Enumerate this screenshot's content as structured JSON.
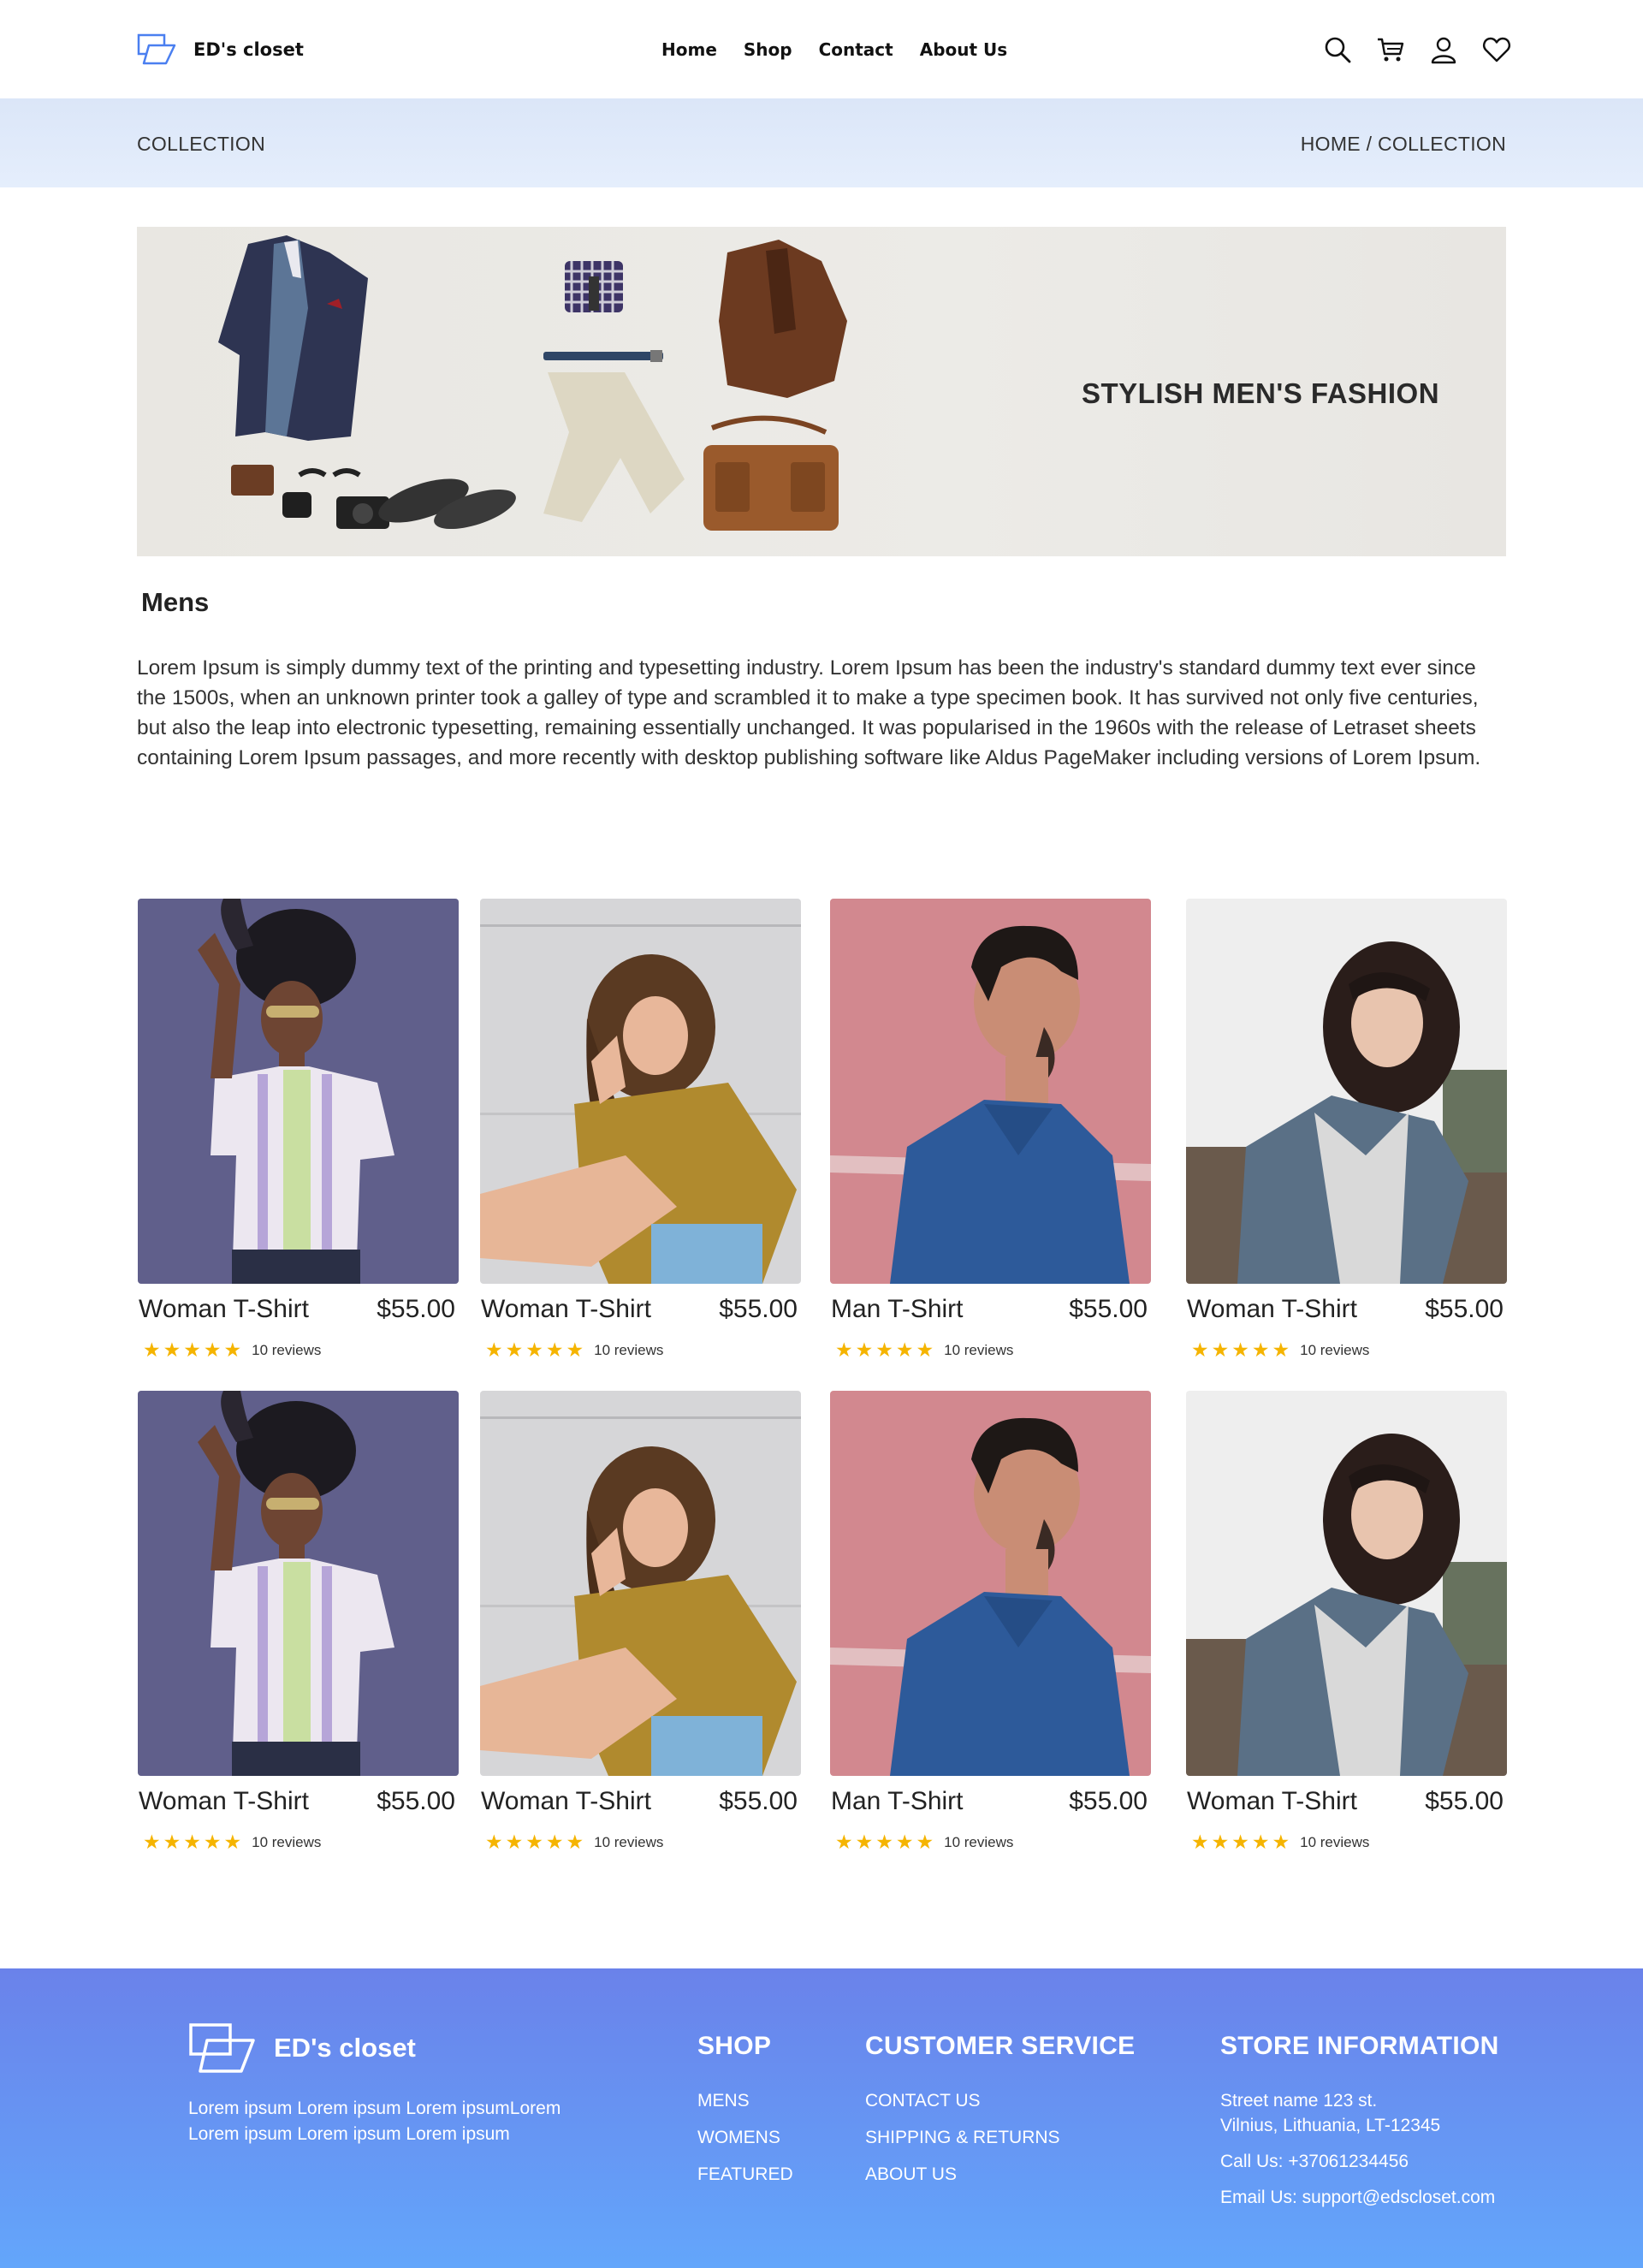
{
  "header": {
    "brand": "ED's closet",
    "nav": [
      "Home",
      "Shop",
      "Contact",
      "About Us"
    ],
    "icons": [
      "search-icon",
      "cart-icon",
      "user-icon",
      "heart-icon"
    ]
  },
  "breadcrumb": {
    "section": "COLLECTION",
    "path": "HOME / COLLECTION"
  },
  "banner": {
    "title": "STYLISH MEN'S FASHION"
  },
  "category": {
    "title": "Mens",
    "description": "Lorem Ipsum is simply dummy text of the printing and typesetting industry. Lorem Ipsum has been the industry's standard dummy text ever since the 1500s, when an unknown printer took a galley of type and scrambled it to make a type specimen book. It has survived not only five centuries, but also the leap into electronic typesetting, remaining essentially unchanged. It was popularised in the 1960s with the release of Letraset sheets containing Lorem Ipsum passages, and more recently with desktop publishing software like Aldus PageMaker including versions of Lorem Ipsum."
  },
  "products": [
    {
      "name": "Woman T-Shirt",
      "price": "$55.00",
      "stars": 5,
      "reviews": "10 reviews"
    },
    {
      "name": "Woman T-Shirt",
      "price": "$55.00",
      "stars": 5,
      "reviews": "10 reviews"
    },
    {
      "name": "Man T-Shirt",
      "price": "$55.00",
      "stars": 5,
      "reviews": "10 reviews"
    },
    {
      "name": "Woman T-Shirt",
      "price": "$55.00",
      "stars": 5,
      "reviews": "10 reviews"
    },
    {
      "name": "Woman T-Shirt",
      "price": "$55.00",
      "stars": 5,
      "reviews": "10 reviews"
    },
    {
      "name": "Woman T-Shirt",
      "price": "$55.00",
      "stars": 5,
      "reviews": "10 reviews"
    },
    {
      "name": "Man T-Shirt",
      "price": "$55.00",
      "stars": 5,
      "reviews": "10 reviews"
    },
    {
      "name": "Woman T-Shirt",
      "price": "$55.00",
      "stars": 5,
      "reviews": "10 reviews"
    }
  ],
  "footer": {
    "brand": "ED's closet",
    "about": "Lorem ipsum Lorem ipsum Lorem ipsumLorem Lorem ipsum Lorem ipsum Lorem ipsum",
    "shop": {
      "heading": "SHOP",
      "links": [
        "MENS",
        "WOMENS",
        "FEATURED"
      ]
    },
    "service": {
      "heading": "CUSTOMER SERVICE",
      "links": [
        "CONTACT US",
        "SHIPPING & RETURNS",
        "ABOUT US"
      ]
    },
    "store": {
      "heading": "STORE INFORMATION",
      "address_line1": "Street name 123 st.",
      "address_line2": "Vilnius, Lithuania, LT-12345",
      "phone": "Call Us: +37061234456",
      "email": "Email Us: support@edscloset.com"
    }
  },
  "colors": {
    "accent": "#4a7ff0",
    "star": "#f5b400",
    "footer_top": "#6a82ea",
    "footer_bottom": "#63a6fb",
    "band": "#dbe6f8"
  }
}
